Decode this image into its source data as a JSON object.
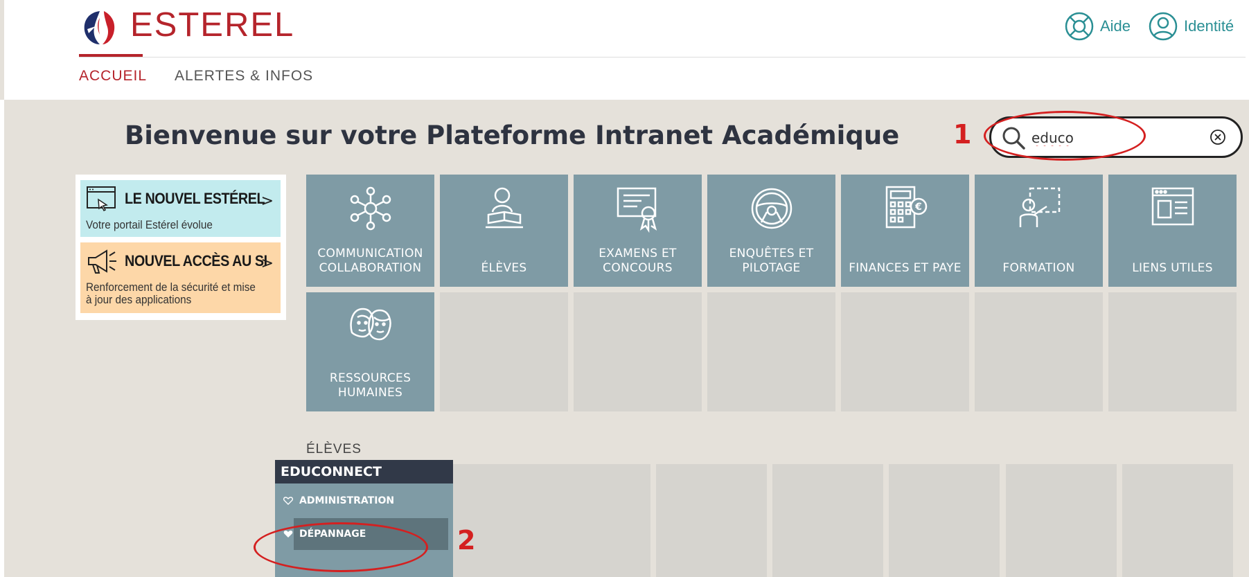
{
  "brand": {
    "name": "ESTEREL"
  },
  "nav": {
    "home": "ACCUEIL",
    "alerts": "ALERTES & INFOS"
  },
  "header_links": {
    "help": "Aide",
    "identity": "Identité"
  },
  "page": {
    "title": "Bienvenue sur votre Plateforme Intranet Académique"
  },
  "search": {
    "value": "educo"
  },
  "annotations": {
    "first": "1",
    "second": "2"
  },
  "news": [
    {
      "title": "LE NOUVEL ESTÉREL",
      "subtitle": [
        "Votre portail Estérel évolue"
      ],
      "arrow": ">"
    },
    {
      "title": "NOUVEL ACCÈS AU SI",
      "subtitle": [
        "Renforcement de la sécurité et mise",
        "à jour des applications"
      ],
      "arrow": ">"
    }
  ],
  "tiles": [
    {
      "label": [
        "COMMUNICATION",
        "COLLABORATION"
      ],
      "icon": "network-icon"
    },
    {
      "label": [
        "ÉLÈVES"
      ],
      "icon": "student-reading-icon"
    },
    {
      "label": [
        "EXAMENS ET",
        "CONCOURS"
      ],
      "icon": "certificate-icon"
    },
    {
      "label": [
        "ENQUÊTES ET",
        "PILOTAGE"
      ],
      "icon": "steering-wheel-icon"
    },
    {
      "label": [
        "FINANCES ET PAYE"
      ],
      "icon": "calculator-icon"
    },
    {
      "label": [
        "FORMATION"
      ],
      "icon": "teacher-board-icon"
    },
    {
      "label": [
        "LIENS UTILES"
      ],
      "icon": "browser-window-icon"
    },
    {
      "label": [
        "RESSOURCES",
        "HUMAINES"
      ],
      "icon": "people-faces-icon"
    }
  ],
  "results": {
    "section_label": "ÉLÈVES",
    "app_title": "EDUCONNECT",
    "items": [
      {
        "label": "ADMINISTRATION",
        "favorite": false
      },
      {
        "label": "DÉPANNAGE",
        "favorite": true
      }
    ]
  },
  "colors": {
    "brand_red": "#b5242b",
    "teal": "#2a8f94",
    "tile": "#7f9ba5",
    "tile_empty": "#d6d4cf",
    "background": "#e5e1da",
    "annotation_red": "#d42020"
  }
}
